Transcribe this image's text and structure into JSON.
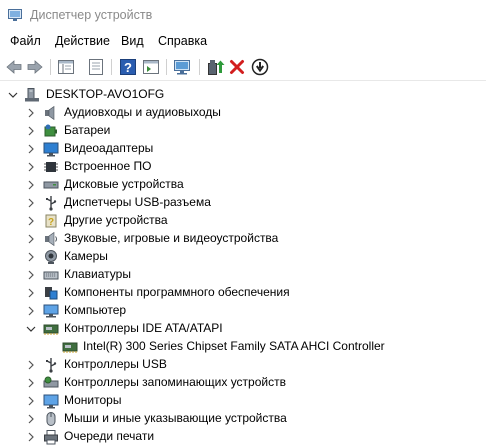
{
  "window": {
    "title": "Диспетчер устройств"
  },
  "menu": {
    "file": "Файл",
    "action": "Действие",
    "view": "Вид",
    "help": "Справка"
  },
  "toolbar": {
    "buttons": [
      "back-icon",
      "forward-icon",
      "show-hide-tree-icon",
      "properties-icon",
      "help-icon",
      "view-icon",
      "scan-hardware-icon",
      "update-driver-icon",
      "uninstall-icon",
      "disable-icon"
    ],
    "colors": {
      "uninstall_red": "#d21e1e",
      "help_blue": "#2a5db0"
    }
  },
  "tree": {
    "root": "DESKTOP-AVO1OFG",
    "categories": [
      {
        "label": "Аудиовходы и аудиовыходы",
        "icon": "speaker-icon",
        "expanded": false
      },
      {
        "label": "Батареи",
        "icon": "battery-icon",
        "expanded": false
      },
      {
        "label": "Видеоадаптеры",
        "icon": "monitor-adapter-icon",
        "expanded": false
      },
      {
        "label": "Встроенное ПО",
        "icon": "firmware-icon",
        "expanded": false
      },
      {
        "label": "Дисковые устройства",
        "icon": "disk-drive-icon",
        "expanded": false
      },
      {
        "label": "Диспетчеры USB-разъема",
        "icon": "usb-connector-icon",
        "expanded": false
      },
      {
        "label": "Другие устройства",
        "icon": "unknown-device-icon",
        "expanded": false
      },
      {
        "label": "Звуковые, игровые и видеоустройства",
        "icon": "sound-icon",
        "expanded": false
      },
      {
        "label": "Камеры",
        "icon": "camera-icon",
        "expanded": false
      },
      {
        "label": "Клавиатуры",
        "icon": "keyboard-icon",
        "expanded": false
      },
      {
        "label": "Компоненты программного обеспечения",
        "icon": "software-component-icon",
        "expanded": false
      },
      {
        "label": "Компьютер",
        "icon": "computer-icon",
        "expanded": false
      },
      {
        "label": "Контроллеры IDE ATA/ATAPI",
        "icon": "ide-controller-icon",
        "expanded": true,
        "children": [
          {
            "label": "Intel(R) 300 Series Chipset Family SATA AHCI Controller",
            "icon": "ide-controller-icon"
          }
        ]
      },
      {
        "label": "Контроллеры USB",
        "icon": "usb-controller-icon",
        "expanded": false
      },
      {
        "label": "Контроллеры запоминающих устройств",
        "icon": "storage-controller-icon",
        "expanded": false
      },
      {
        "label": "Мониторы",
        "icon": "monitor-icon",
        "expanded": false
      },
      {
        "label": "Мыши и иные указывающие устройства",
        "icon": "mouse-icon",
        "expanded": false
      },
      {
        "label": "Очереди печати",
        "icon": "printer-icon",
        "expanded": false
      }
    ]
  }
}
